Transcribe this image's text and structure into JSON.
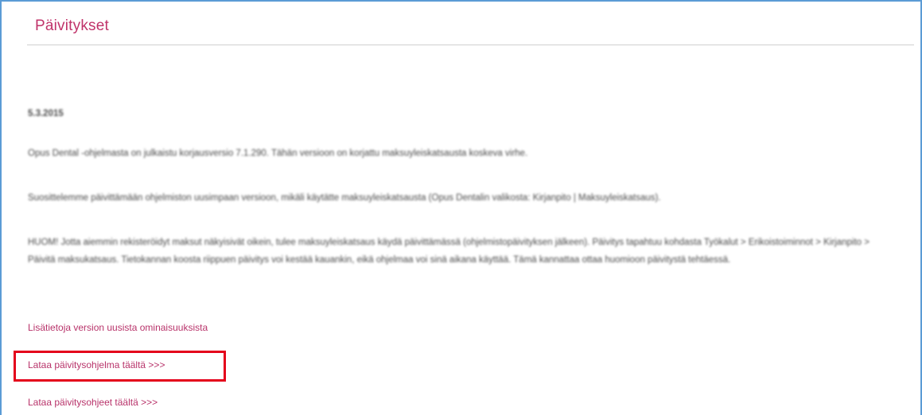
{
  "header": {
    "title": "Päivitykset"
  },
  "article": {
    "date": "5.3.2015",
    "paragraph1": "Opus Dental -ohjelmasta on julkaistu korjausversio 7.1.290. Tähän versioon on korjattu maksuyleiskatsausta koskeva virhe.",
    "paragraph2": "Suosittelemme päivittämään ohjelmiston uusimpaan versioon, mikäli käytätte maksuyleiskatsausta (Opus Dentalin valikosta: Kirjanpito | Maksuyleiskatsaus).",
    "paragraph3": "HUOM! Jotta aiemmin rekisteröidyt maksut näkyisivät oikein, tulee maksuyleiskatsaus käydä päivittämässä (ohjelmistopäivityksen jälkeen). Päivitys tapahtuu kohdasta Työkalut > Erikoistoiminnot > Kirjanpito > Päivitä maksukatsaus. Tietokannan koosta riippuen päivitys voi kestää kauankin, eikä ohjelmaa voi sinä aikana käyttää. Tämä kannattaa ottaa huomioon päivitystä tehtäessä."
  },
  "links": {
    "features": "Lisätietoja version uusista ominaisuuksista",
    "download_program": "Lataa päivitysohjelma täältä >>>",
    "download_instructions": "Lataa päivitysohjeet täältä >>>"
  },
  "colors": {
    "title": "#c0336a",
    "link": "#b8336a",
    "highlight_border": "#e4001b",
    "frame_border": "#5b9bd5"
  }
}
